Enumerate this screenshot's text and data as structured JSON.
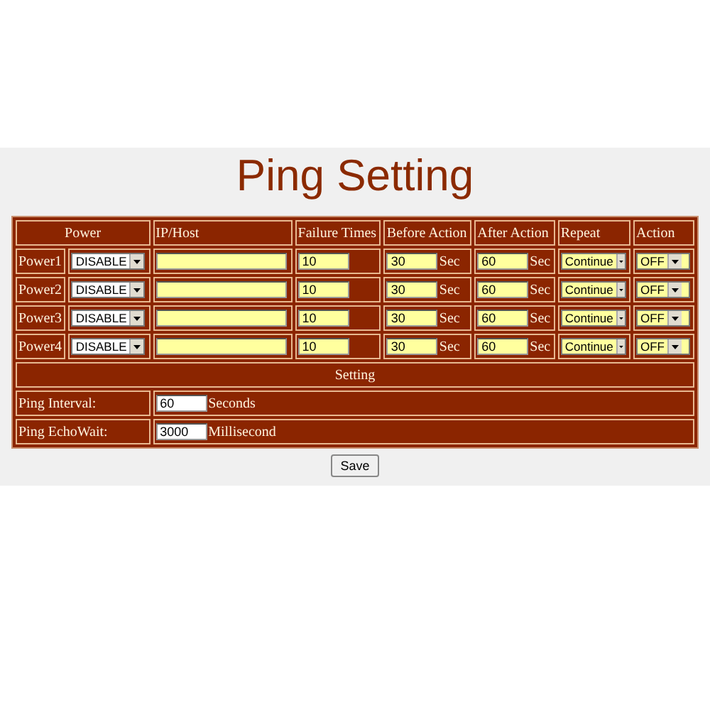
{
  "title": "Ping Setting",
  "table": {
    "columns": [
      "Power",
      "IP/Host",
      "Failure Times",
      "Before Action",
      "After Action",
      "Repeat",
      "Action"
    ],
    "rows": [
      {
        "label": "Power1",
        "power": "DISABLE",
        "ip_host": "",
        "failure_times": "10",
        "before_action": "30",
        "before_unit": "Sec",
        "after_action": "60",
        "after_unit": "Sec",
        "repeat": "Continue",
        "action": "OFF"
      },
      {
        "label": "Power2",
        "power": "DISABLE",
        "ip_host": "",
        "failure_times": "10",
        "before_action": "30",
        "before_unit": "Sec",
        "after_action": "60",
        "after_unit": "Sec",
        "repeat": "Continue",
        "action": "OFF"
      },
      {
        "label": "Power3",
        "power": "DISABLE",
        "ip_host": "",
        "failure_times": "10",
        "before_action": "30",
        "before_unit": "Sec",
        "after_action": "60",
        "after_unit": "Sec",
        "repeat": "Continue",
        "action": "OFF"
      },
      {
        "label": "Power4",
        "power": "DISABLE",
        "ip_host": "",
        "failure_times": "10",
        "before_action": "30",
        "before_unit": "Sec",
        "after_action": "60",
        "after_unit": "Sec",
        "repeat": "Continue",
        "action": "OFF"
      }
    ]
  },
  "setting": {
    "heading": "Setting",
    "fields": [
      {
        "label": "Ping Interval:",
        "value": "60",
        "unit": "Seconds"
      },
      {
        "label": "Ping EchoWait:",
        "value": "3000",
        "unit": "Millisecond"
      }
    ]
  },
  "buttons": [
    "Save"
  ]
}
